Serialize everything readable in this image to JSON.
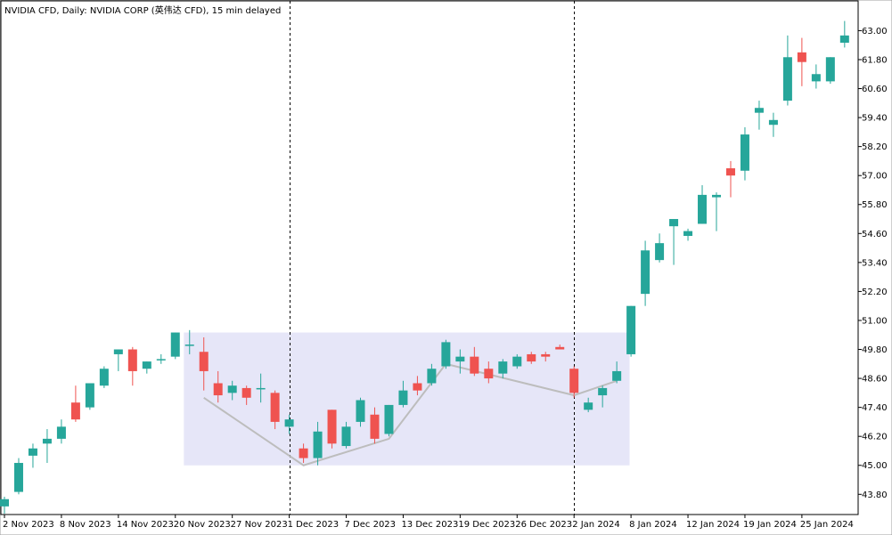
{
  "header": {
    "title": "NVIDIA CFD, Daily:  NVIDIA CORP (英伟达 CFD), 15 min delayed"
  },
  "chart_data": {
    "type": "candlestick",
    "title": "NVIDIA CFD, Daily:  NVIDIA CORP (英伟达 CFD), 15 min delayed",
    "ylim": [
      43.0,
      63.9
    ],
    "y_ticks": [
      "63.00",
      "61.80",
      "60.60",
      "59.40",
      "58.20",
      "57.00",
      "55.80",
      "54.60",
      "53.40",
      "52.20",
      "51.00",
      "49.80",
      "48.60",
      "47.40",
      "46.20",
      "45.00",
      "43.80"
    ],
    "x_labels": [
      {
        "label": "2 Nov 2023",
        "index": 0
      },
      {
        "label": "8 Nov 2023",
        "index": 4
      },
      {
        "label": "14 Nov 2023",
        "index": 8
      },
      {
        "label": "20 Nov 2023",
        "index": 12
      },
      {
        "label": "27 Nov 2023",
        "index": 16
      },
      {
        "label": "1 Dec 2023",
        "index": 20
      },
      {
        "label": "7 Dec 2023",
        "index": 24
      },
      {
        "label": "13 Dec 2023",
        "index": 28
      },
      {
        "label": "19 Dec 2023",
        "index": 32
      },
      {
        "label": "26 Dec 2023",
        "index": 36
      },
      {
        "label": "2 Jan 2024",
        "index": 40
      },
      {
        "label": "8 Jan 2024",
        "index": 44
      },
      {
        "label": "12 Jan 2024",
        "index": 48
      },
      {
        "label": "19 Jan 2024",
        "index": 52
      },
      {
        "label": "25 Jan 2024",
        "index": 56
      }
    ],
    "colors": {
      "up": "#26a69a",
      "down": "#ef5350",
      "box": "#e6e6f8",
      "zigzag": "#bdbdbd"
    },
    "candles": [
      {
        "o": 43.3,
        "h": 43.7,
        "l": 43.0,
        "c": 43.6
      },
      {
        "o": 43.9,
        "h": 45.3,
        "l": 43.8,
        "c": 45.1
      },
      {
        "o": 45.4,
        "h": 45.9,
        "l": 44.9,
        "c": 45.7
      },
      {
        "o": 45.9,
        "h": 46.5,
        "l": 45.1,
        "c": 46.1
      },
      {
        "o": 46.1,
        "h": 46.9,
        "l": 45.9,
        "c": 46.6
      },
      {
        "o": 47.6,
        "h": 48.3,
        "l": 46.8,
        "c": 46.9
      },
      {
        "o": 47.4,
        "h": 48.4,
        "l": 47.3,
        "c": 48.4
      },
      {
        "o": 48.3,
        "h": 49.1,
        "l": 48.2,
        "c": 49.0
      },
      {
        "o": 49.6,
        "h": 49.8,
        "l": 48.9,
        "c": 49.8
      },
      {
        "o": 49.8,
        "h": 49.9,
        "l": 48.3,
        "c": 48.9
      },
      {
        "o": 49.0,
        "h": 49.3,
        "l": 48.8,
        "c": 49.3
      },
      {
        "o": 49.4,
        "h": 49.6,
        "l": 49.2,
        "c": 49.4
      },
      {
        "o": 49.5,
        "h": 50.5,
        "l": 49.4,
        "c": 50.5
      },
      {
        "o": 50.0,
        "h": 50.6,
        "l": 49.6,
        "c": 50.0
      },
      {
        "o": 49.7,
        "h": 50.3,
        "l": 48.1,
        "c": 48.9
      },
      {
        "o": 48.4,
        "h": 48.9,
        "l": 47.6,
        "c": 47.9
      },
      {
        "o": 48.0,
        "h": 48.5,
        "l": 47.7,
        "c": 48.3
      },
      {
        "o": 48.2,
        "h": 48.3,
        "l": 47.5,
        "c": 47.8
      },
      {
        "o": 48.2,
        "h": 48.8,
        "l": 47.6,
        "c": 48.2
      },
      {
        "o": 48.0,
        "h": 48.1,
        "l": 46.5,
        "c": 46.8
      },
      {
        "o": 46.6,
        "h": 47.1,
        "l": 46.3,
        "c": 46.9
      },
      {
        "o": 45.7,
        "h": 45.9,
        "l": 45.1,
        "c": 45.3
      },
      {
        "o": 45.3,
        "h": 46.8,
        "l": 45.0,
        "c": 46.4
      },
      {
        "o": 47.3,
        "h": 47.3,
        "l": 45.7,
        "c": 45.9
      },
      {
        "o": 45.8,
        "h": 46.8,
        "l": 45.7,
        "c": 46.6
      },
      {
        "o": 46.8,
        "h": 47.8,
        "l": 46.6,
        "c": 47.7
      },
      {
        "o": 47.1,
        "h": 47.4,
        "l": 45.9,
        "c": 46.1
      },
      {
        "o": 46.3,
        "h": 47.5,
        "l": 46.2,
        "c": 47.5
      },
      {
        "o": 47.5,
        "h": 48.5,
        "l": 47.4,
        "c": 48.1
      },
      {
        "o": 48.4,
        "h": 48.7,
        "l": 47.9,
        "c": 48.1
      },
      {
        "o": 48.4,
        "h": 49.2,
        "l": 48.3,
        "c": 49.0
      },
      {
        "o": 49.1,
        "h": 50.2,
        "l": 49.0,
        "c": 50.1
      },
      {
        "o": 49.3,
        "h": 49.8,
        "l": 48.8,
        "c": 49.5
      },
      {
        "o": 49.5,
        "h": 49.9,
        "l": 48.7,
        "c": 48.8
      },
      {
        "o": 49.0,
        "h": 49.3,
        "l": 48.4,
        "c": 48.6
      },
      {
        "o": 48.8,
        "h": 49.4,
        "l": 48.6,
        "c": 49.3
      },
      {
        "o": 49.1,
        "h": 49.6,
        "l": 49.0,
        "c": 49.5
      },
      {
        "o": 49.6,
        "h": 49.7,
        "l": 49.2,
        "c": 49.3
      },
      {
        "o": 49.6,
        "h": 49.7,
        "l": 49.3,
        "c": 49.5
      },
      {
        "o": 49.9,
        "h": 50.0,
        "l": 49.8,
        "c": 49.8
      },
      {
        "o": 49.0,
        "h": 49.1,
        "l": 47.8,
        "c": 48.0
      },
      {
        "o": 47.3,
        "h": 47.8,
        "l": 47.2,
        "c": 47.6
      },
      {
        "o": 47.9,
        "h": 48.3,
        "l": 47.4,
        "c": 48.2
      },
      {
        "o": 48.5,
        "h": 49.3,
        "l": 48.4,
        "c": 48.9
      },
      {
        "o": 49.6,
        "h": 51.6,
        "l": 49.5,
        "c": 51.6
      },
      {
        "o": 52.1,
        "h": 54.3,
        "l": 51.6,
        "c": 53.9
      },
      {
        "o": 53.5,
        "h": 54.6,
        "l": 53.4,
        "c": 54.2
      },
      {
        "o": 54.9,
        "h": 55.2,
        "l": 53.3,
        "c": 55.2
      },
      {
        "o": 54.5,
        "h": 54.8,
        "l": 54.3,
        "c": 54.7
      },
      {
        "o": 55.0,
        "h": 56.6,
        "l": 55.0,
        "c": 56.2
      },
      {
        "o": 56.1,
        "h": 56.3,
        "l": 54.7,
        "c": 56.2
      },
      {
        "o": 57.3,
        "h": 57.6,
        "l": 56.1,
        "c": 57.0
      },
      {
        "o": 57.2,
        "h": 59.0,
        "l": 56.8,
        "c": 58.7
      },
      {
        "o": 59.6,
        "h": 60.1,
        "l": 58.9,
        "c": 59.8
      },
      {
        "o": 59.1,
        "h": 59.6,
        "l": 58.6,
        "c": 59.3
      },
      {
        "o": 60.1,
        "h": 62.8,
        "l": 59.9,
        "c": 61.9
      },
      {
        "o": 62.1,
        "h": 62.7,
        "l": 60.7,
        "c": 61.7
      },
      {
        "o": 60.9,
        "h": 61.6,
        "l": 60.6,
        "c": 61.2
      },
      {
        "o": 60.9,
        "h": 61.9,
        "l": 60.8,
        "c": 61.9
      },
      {
        "o": 62.5,
        "h": 63.4,
        "l": 62.3,
        "c": 62.8
      }
    ],
    "box": {
      "x0": 12.6,
      "x1": 43.9,
      "y_low": 45.0,
      "y_high": 50.5
    },
    "zigzag": [
      {
        "i": 14,
        "y": 47.8
      },
      {
        "i": 21,
        "y": 45.0
      },
      {
        "i": 27,
        "y": 46.1
      },
      {
        "i": 31,
        "y": 49.2
      },
      {
        "i": 40,
        "y": 47.9
      },
      {
        "i": 43,
        "y": 48.5
      }
    ],
    "vlines": [
      20,
      40
    ]
  }
}
